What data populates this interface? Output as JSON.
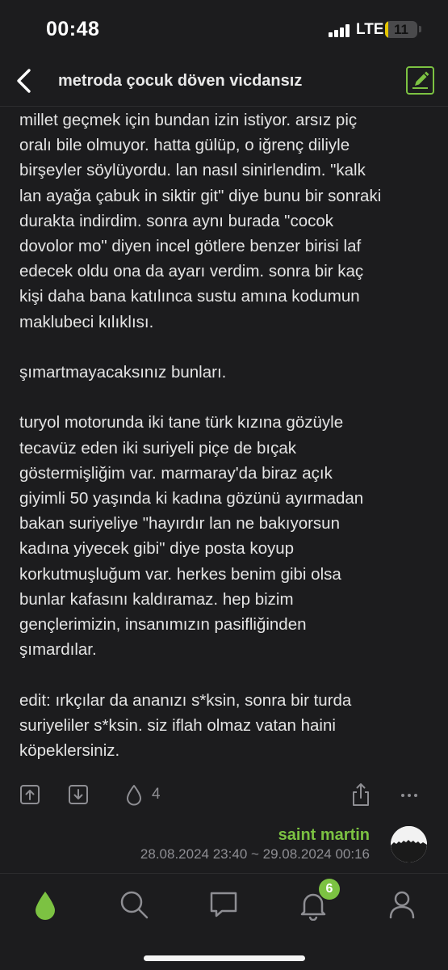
{
  "status_bar": {
    "time": "00:48",
    "network": "LTE",
    "battery_level": "11"
  },
  "header": {
    "title": "metroda çocuk döven vicdansız"
  },
  "entry": {
    "paragraphs": [
      [
        "millet geçmek için bundan izin istiyor. arsız piç",
        "oralı bile olmuyor. hatta gülüp, o iğrenç diliyle",
        "birşeyler söylüyordu. lan nasıl sinirlendim. \"kalk",
        "lan ayağa çabuk in siktir git\" diye bunu bir sonraki",
        "durakta indirdim. sonra aynı burada \"cocok",
        "dovolor mo\" diyen incel götlere benzer birisi laf",
        "edecek oldu ona da ayarı verdim. sonra bir kaç",
        "kişi daha bana katılınca sustu amına kodumun",
        "maklubeci kılıklısı."
      ],
      [
        "şımartmayacaksınız bunları."
      ],
      [
        "turyol motorunda iki tane türk kızına gözüyle",
        "tecavüz eden iki suriyeli piçe de bıçak",
        "göstermişliğim var. marmaray'da biraz açık",
        "giyimli 50 yaşında ki kadına gözünü ayırmadan",
        "bakan suriyeliye \"hayırdır lan ne bakıyorsun",
        "kadına yiyecek gibi\" diye posta koyup",
        "korkutmuşluğum var. herkes benim gibi olsa",
        "bunlar kafasını kaldıramaz. hep bizim",
        "gençlerimizin, insanımızın pasifliğinden",
        "şımardılar."
      ],
      [
        "edit: ırkçılar da ananızı s*ksin, sonra bir turda",
        "suriyeliler s*ksin. siz iflah olmaz vatan haini",
        "köpeklersiniz."
      ]
    ],
    "vote_count": "4",
    "author": "saint martin",
    "date": "28.08.2024 23:40 ~ 29.08.2024 00:16"
  },
  "icons": {
    "back": "chevron-left-icon",
    "edit": "compose-icon",
    "upvote": "arrow-up-box-icon",
    "downvote": "arrow-down-box-icon",
    "favorite": "drop-icon",
    "share": "share-icon",
    "more": "ellipsis-icon"
  },
  "tabbar": {
    "tabs": [
      "home-drop",
      "search",
      "messages",
      "notifications",
      "profile"
    ],
    "notification_badge": "6"
  },
  "colors": {
    "accent": "#7cc242",
    "background": "#1c1c1e",
    "text": "#e4e4e4",
    "muted": "#8e8e93"
  }
}
